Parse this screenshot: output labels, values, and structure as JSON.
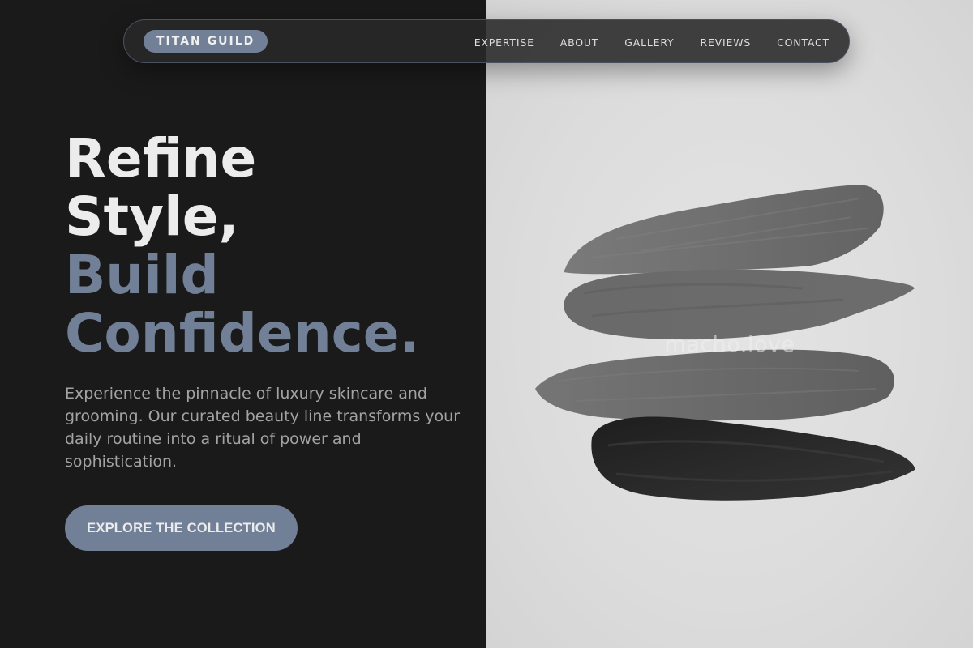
{
  "brand": {
    "name": "TITAN GUILD"
  },
  "nav": {
    "links": [
      "EXPERTISE",
      "ABOUT",
      "GALLERY",
      "REVIEWS",
      "CONTACT"
    ]
  },
  "hero": {
    "heading_lines": [
      "Refine",
      "Style,",
      "Build",
      "Confidence."
    ],
    "description": "Experience the pinnacle of luxury skincare and grooming. Our curated beauty line transforms your daily routine into a ritual of power and sophistication.",
    "cta_label": "EXPLORE THE COLLECTION"
  },
  "artwork": {
    "watermark": "macho.love"
  },
  "colors": {
    "background_dark": "#1a1a1a",
    "accent": "#718096",
    "heading_light": "#ececec",
    "body_text": "#a3a3a3",
    "right_panel": "#dcdcdc"
  }
}
